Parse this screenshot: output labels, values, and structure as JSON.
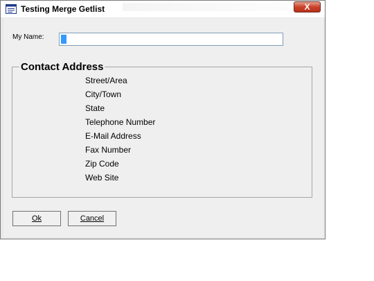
{
  "window": {
    "title": "Testing Merge Getlist",
    "close_label": "X"
  },
  "form": {
    "name_label": "My Name:",
    "name_value": ""
  },
  "contact": {
    "title": "Contact Address",
    "fields": [
      "Street/Area",
      "City/Town",
      "State",
      "Telephone Number",
      "E-Mail Address",
      "Fax Number",
      "Zip Code",
      "Web Site"
    ]
  },
  "buttons": {
    "ok_label": "Ok",
    "cancel_label": "Cancel"
  }
}
